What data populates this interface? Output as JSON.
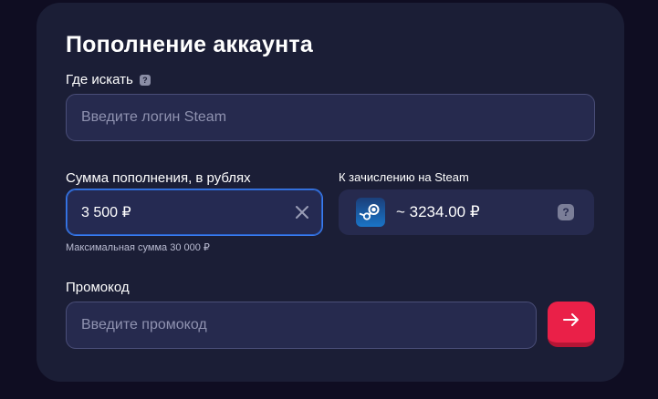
{
  "card": {
    "title": "Пополнение аккаунта",
    "login": {
      "label": "Где искать",
      "help_glyph": "?",
      "placeholder": "Введите логин Steam"
    },
    "amount": {
      "label": "Сумма пополнения, в рублях",
      "value": "3 500 ₽",
      "hint": "Максимальная сумма 30 000 ₽",
      "clear_icon": "close-icon"
    },
    "credit": {
      "label": "К зачислению на Steam",
      "value": "~ 3234.00 ₽",
      "logo_icon": "steam-logo-icon",
      "help_glyph": "?"
    },
    "promo": {
      "label": "Промокод",
      "placeholder": "Введите промокод",
      "submit_icon": "arrow-right-icon"
    }
  },
  "colors": {
    "background": "#0f0d22",
    "card": "#1b1e36",
    "field": "#262a4e",
    "accent_blue": "#3b7cf0",
    "accent_red": "#ea2048"
  }
}
